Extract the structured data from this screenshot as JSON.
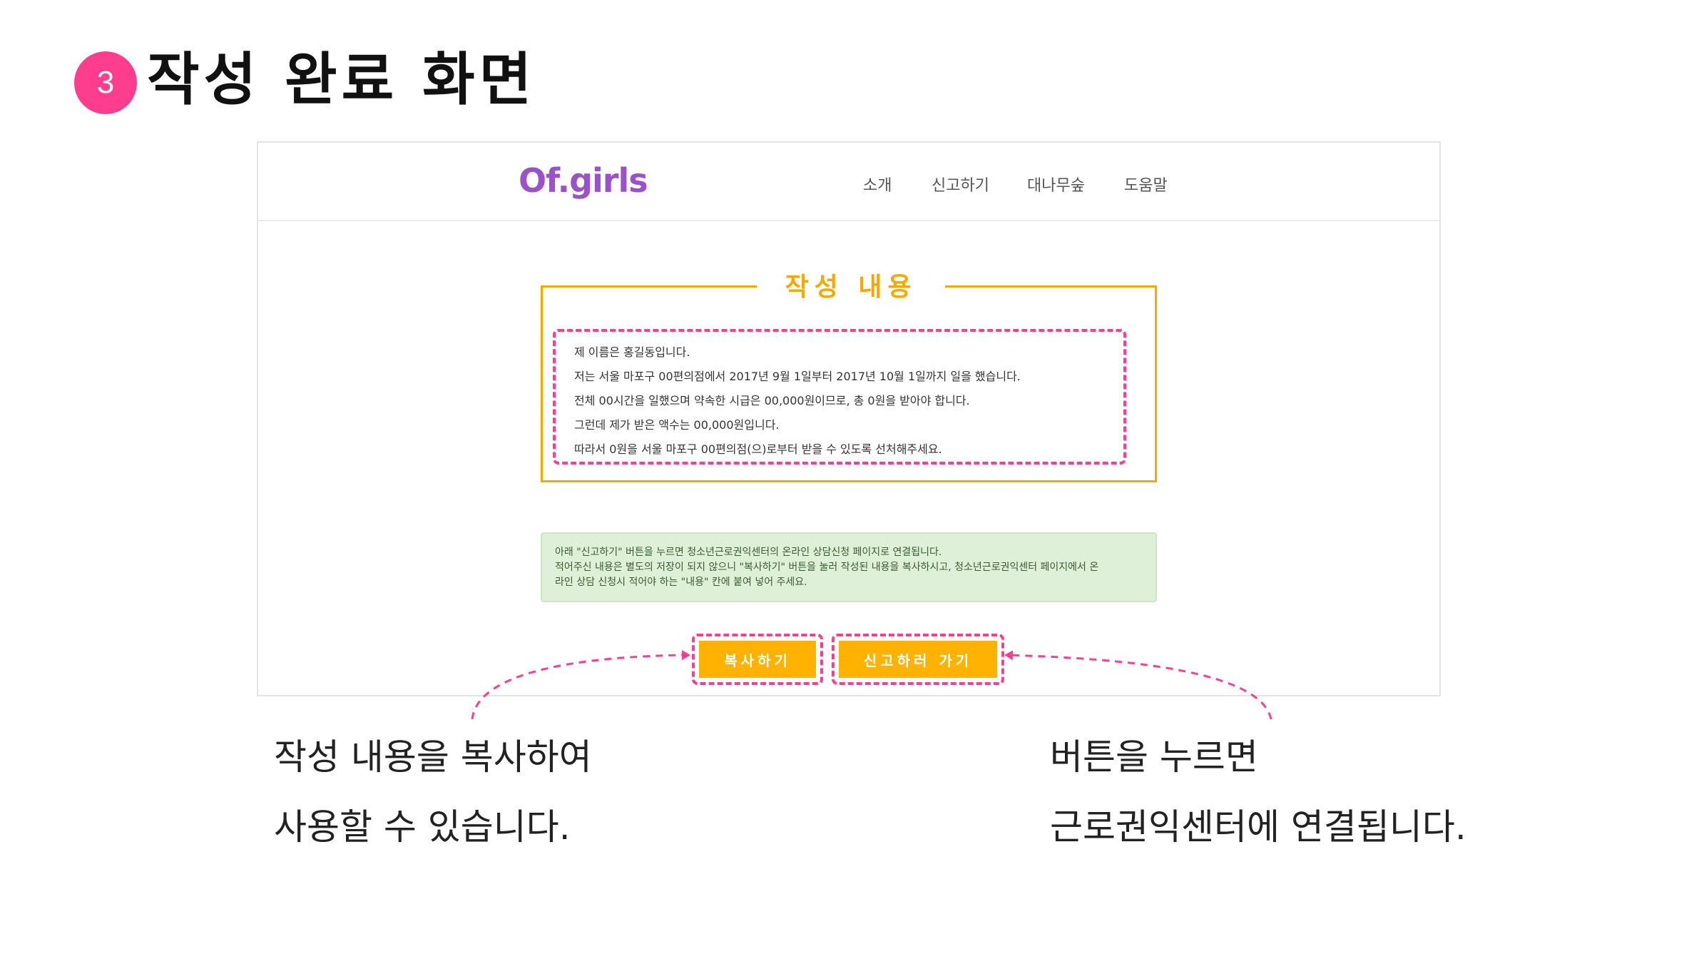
{
  "slide": {
    "step_number": "3",
    "title": "작성 완료 화면"
  },
  "screen": {
    "logo": "Of.girls",
    "nav": [
      "소개",
      "신고하기",
      "대나무숲",
      "도움말"
    ],
    "content_box": {
      "title": "작성 내용",
      "lines": [
        "제 이름은 홍길동입니다.",
        "저는 서울 마포구 00편의점에서 2017년 9월 1일부터 2017년 10월 1일까지 일을 했습니다.",
        "전체 00시간을 일했으며 약속한 시급은 00,000원이므로, 총 0원을 받아야 합니다.",
        "그런데 제가 받은 액수는 00,000원입니다.",
        "따라서 0원을 서울 마포구 00편의점(으)로부터 받을 수 있도록 선처해주세요."
      ]
    },
    "notice": [
      "아래 \"신고하기\" 버튼을 누르면 청소년근로권익센터의 온라인 상담신청 페이지로 연결됩니다.",
      "적어주신 내용은 별도의 저장이 되지 않으니 \"복사하기\" 버튼을 눌러 작성된 내용을 복사하시고, 청소년근로권익센터 페이지에서 온",
      "라인 상담 신청시 적어야 하는 \"내용\" 칸에 붙여 넣어 주세요."
    ],
    "buttons": {
      "copy": "복사하기",
      "report": "신고하러 가기"
    }
  },
  "captions": {
    "left": [
      "작성 내용을 복사하여",
      "사용할 수 있습니다."
    ],
    "right": [
      "버튼을 누르면",
      "근로권익센터에 연결됩니다."
    ]
  },
  "colors": {
    "accent_pink": "#ff3d8f",
    "accent_orange": "#f5a800",
    "button_orange": "#ffb300",
    "logo_purple": "#9b51c7",
    "notice_green": "#dff0d8"
  }
}
